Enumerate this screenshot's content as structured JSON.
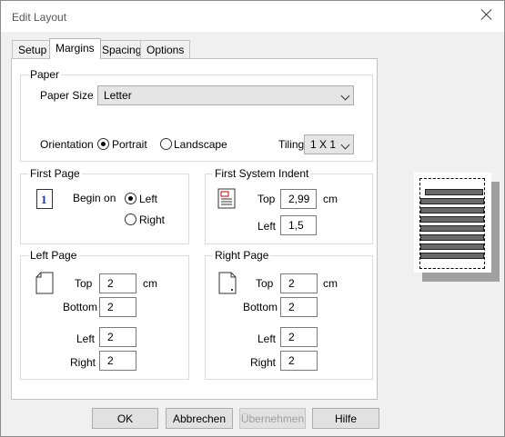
{
  "window": {
    "title": "Edit Layout"
  },
  "tabs": [
    "Setup",
    "Margins",
    "Spacing",
    "Options"
  ],
  "paper": {
    "group_label": "Paper",
    "paper_size_label": "Paper Size",
    "paper_size_value": "Letter",
    "orientation_label": "Orientation",
    "portrait_label": "Portrait",
    "landscape_label": "Landscape",
    "orientation_selected": "Portrait",
    "tiling_label": "Tiling",
    "tiling_value": "1 X 1"
  },
  "first_page": {
    "group_label": "First Page",
    "icon_number": "1",
    "begin_on_label": "Begin on",
    "left_label": "Left",
    "right_label": "Right",
    "selected": "Left"
  },
  "first_system_indent": {
    "group_label": "First System Indent",
    "top_label": "Top",
    "top_value": "2,99",
    "unit": "cm",
    "left_label": "Left",
    "left_value": "1,5"
  },
  "left_page": {
    "group_label": "Left Page",
    "top_label": "Top",
    "top_value": "2",
    "unit": "cm",
    "bottom_label": "Bottom",
    "bottom_value": "2",
    "left_label": "Left",
    "left_value": "2",
    "right_label": "Right",
    "right_value": "2"
  },
  "right_page": {
    "group_label": "Right Page",
    "top_label": "Top",
    "top_value": "2",
    "unit": "cm",
    "bottom_label": "Bottom",
    "bottom_value": "2",
    "left_label": "Left",
    "left_value": "2",
    "right_label": "Right",
    "right_value": "2"
  },
  "buttons": {
    "ok": "OK",
    "cancel": "Abbrechen",
    "apply": "Übernehmen",
    "help": "Hilfe"
  },
  "icons": {
    "close": "close-icon",
    "page": "page-icon",
    "indent": "indent-icon"
  }
}
